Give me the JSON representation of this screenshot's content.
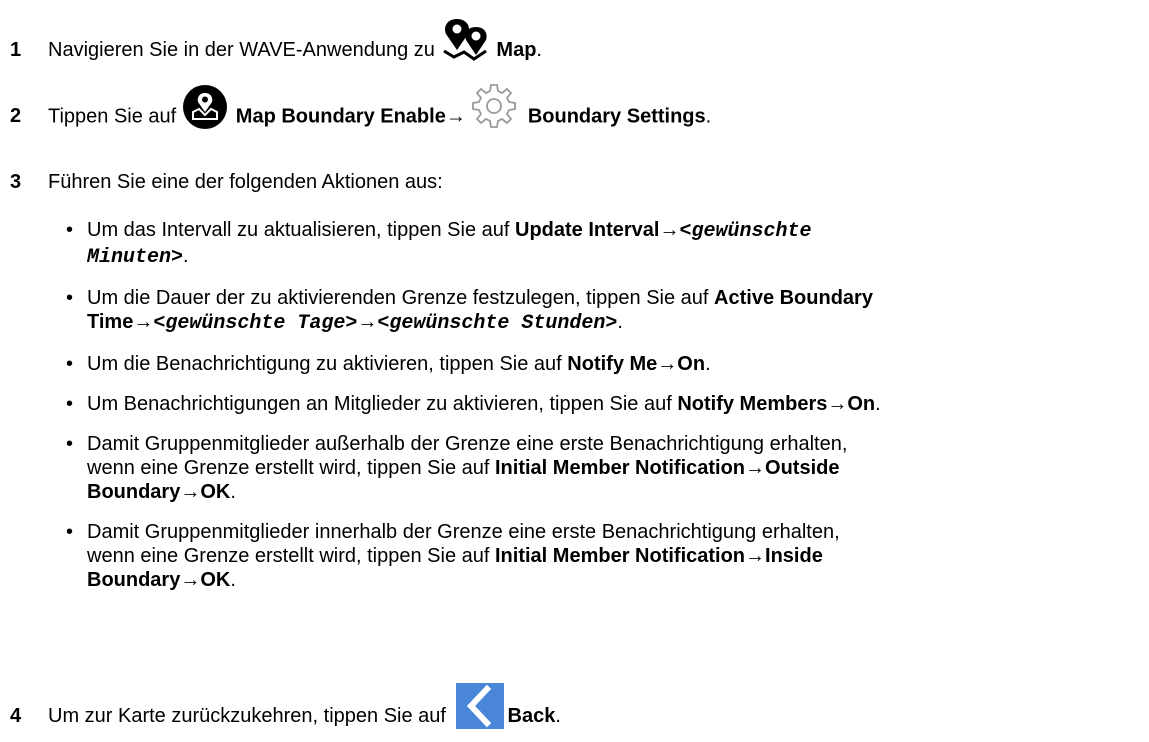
{
  "steps": [
    {
      "num": "1",
      "text1": "Navigieren Sie in der WAVE-Anwendung zu ",
      "icon": "map-pins-icon",
      "bold1": "Map",
      "text2": "."
    },
    {
      "num": "2",
      "text1": "Tippen Sie auf ",
      "icon1": "map-boundary-enable-icon",
      "bold1": "Map Boundary Enable",
      "arrow": "→",
      "icon2": "gear-icon",
      "bold2": "Boundary Settings",
      "text2": "."
    },
    {
      "num": "3",
      "text1": "Führen Sie eine der folgenden Aktionen aus:"
    },
    {
      "num": "4",
      "text1": "Um zur Karte zurückzukehren, tippen Sie auf ",
      "icon": "back-chevron-icon",
      "bold1": "Back",
      "text2": "."
    }
  ],
  "bullets": [
    {
      "t1": "Um das Intervall zu aktualisieren, tippen Sie auf ",
      "b1": "Update Interval",
      "a1": "→",
      "c1": "<gewünschte",
      "c2": "Minuten>",
      "t2": "."
    },
    {
      "t1": "Um die Dauer der zu aktivierenden Grenze festzulegen, tippen Sie auf ",
      "b1": "Active Boundary",
      "b2": "Time",
      "a1": "→",
      "c1": "<gewünschte Tage>",
      "a2": "→",
      "c2": "<gewünschte Stunden>",
      "t2": "."
    },
    {
      "t1": "Um die Benachrichtigung zu aktivieren, tippen Sie auf ",
      "b1": "Notify Me",
      "a1": "→",
      "b2": "On",
      "t2": "."
    },
    {
      "t1": "Um Benachrichtigungen an Mitglieder zu aktivieren, tippen Sie auf ",
      "b1": "Notify Members",
      "a1": "→",
      "b2": "On",
      "t2": "."
    },
    {
      "t1": "Damit Gruppenmitglieder außerhalb der Grenze eine erste Benachrichtigung erhalten,",
      "t2": "wenn eine Grenze erstellt wird, tippen Sie auf ",
      "b1": "Initial Member Notification",
      "a1": "→",
      "b2": "Outside",
      "b3": "Boundary",
      "a2": "→",
      "b4": "OK",
      "t3": "."
    },
    {
      "t1": "Damit Gruppenmitglieder innerhalb der Grenze eine erste Benachrichtigung erhalten,",
      "t2": "wenn eine Grenze erstellt wird, tippen Sie auf ",
      "b1": "Initial Member Notification",
      "a1": "→",
      "b2": "Inside",
      "b3": "Boundary",
      "a2": "→",
      "b4": "OK",
      "t3": "."
    }
  ],
  "colors": {
    "text": "#000000",
    "icon_dark": "#000000",
    "icon_light": "#9a9a9a",
    "back_icon": "#4a86d8"
  }
}
